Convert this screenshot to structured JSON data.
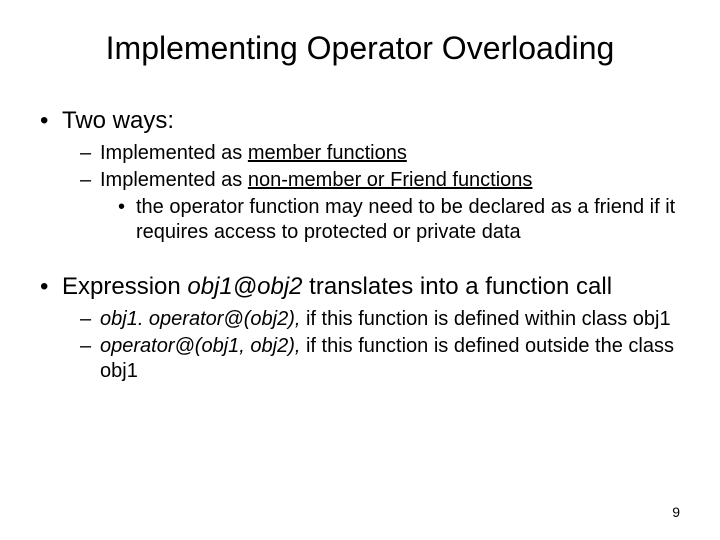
{
  "title": "Implementing Operator Overloading",
  "bullets": {
    "b1": {
      "label": "Two ways:",
      "sub": {
        "s1_pre": "Implemented as ",
        "s1_u": "member functions",
        "s2_pre": "Implemented as ",
        "s2_u": "non-member or Friend functions",
        "s2_sub1": "the operator function may need to be declared as a friend if it requires access to protected or private data"
      }
    },
    "b2": {
      "pre": "Expression ",
      "ital1": "obj1@obj2",
      "post": " translates into a function call",
      "sub": {
        "s1_ital": "obj1. operator@(obj2),",
        "s1_tail": " if this function is defined within class obj1",
        "s2_ital": "operator@(obj1, obj2),",
        "s2_tail": " if this function is defined outside the class obj1"
      }
    }
  },
  "page_number": "9"
}
